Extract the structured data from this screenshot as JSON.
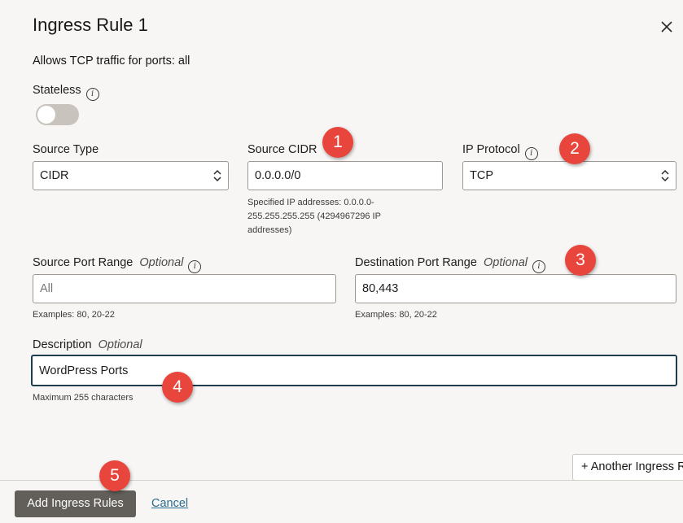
{
  "dialog": {
    "title": "Ingress Rule 1",
    "summary": "Allows TCP traffic for ports: all"
  },
  "stateless": {
    "label": "Stateless",
    "enabled": false
  },
  "source_type": {
    "label": "Source Type",
    "value": "CIDR"
  },
  "source_cidr": {
    "label": "Source CIDR",
    "value": "0.0.0.0/0",
    "help_line1": "Specified IP addresses: 0.0.0.0-",
    "help_line2": "255.255.255.255 (4294967296 IP",
    "help_line3": "addresses)"
  },
  "ip_protocol": {
    "label": "IP Protocol",
    "value": "TCP"
  },
  "source_port_range": {
    "label": "Source Port Range",
    "optional": "Optional",
    "placeholder": "All",
    "help": "Examples: 80, 20-22"
  },
  "destination_port_range": {
    "label": "Destination Port Range",
    "optional": "Optional",
    "value": "80,443",
    "help": "Examples: 80, 20-22"
  },
  "description": {
    "label": "Description",
    "optional": "Optional",
    "value": "WordPress Ports",
    "help": "Maximum 255 characters"
  },
  "badges": [
    "1",
    "2",
    "3",
    "4",
    "5"
  ],
  "footer": {
    "another_button": "+ Another Ingress Rule",
    "add_button": "Add Ingress Rules",
    "cancel": "Cancel"
  },
  "colors": {
    "badge": "#e8453c",
    "primary_button": "#625e59",
    "link": "#2a6b8f"
  }
}
